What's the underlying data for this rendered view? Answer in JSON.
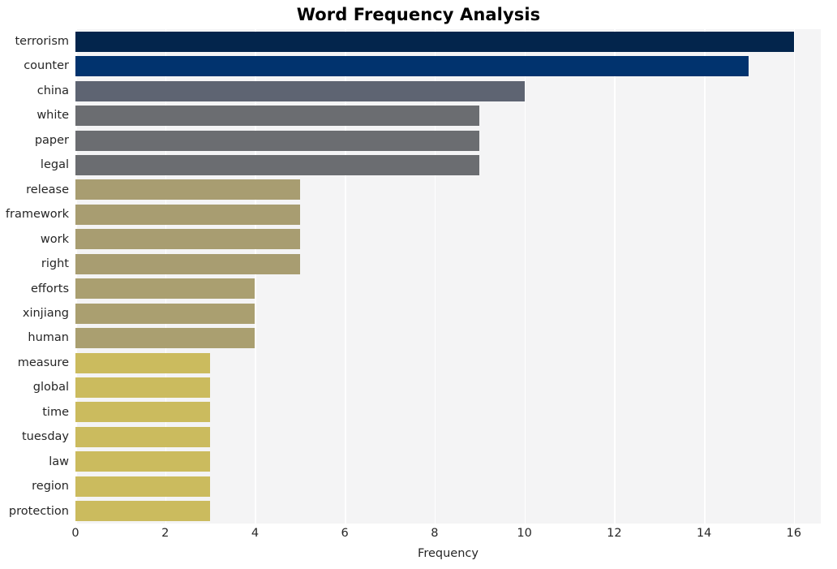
{
  "chart_data": {
    "type": "bar",
    "orientation": "horizontal",
    "title": "Word Frequency Analysis",
    "xlabel": "Frequency",
    "ylabel": "",
    "xlim": [
      0,
      16.6
    ],
    "xticks": [
      0,
      2,
      4,
      6,
      8,
      10,
      12,
      14,
      16
    ],
    "xtick_labels": [
      "0",
      "2",
      "4",
      "6",
      "8",
      "10",
      "12",
      "14",
      "16"
    ],
    "grid": "vertical-only",
    "legend": "none",
    "categories": [
      "terrorism",
      "counter",
      "china",
      "white",
      "paper",
      "legal",
      "release",
      "framework",
      "work",
      "right",
      "efforts",
      "xinjiang",
      "human",
      "measure",
      "global",
      "time",
      "tuesday",
      "law",
      "region",
      "protection"
    ],
    "values": [
      16,
      15,
      10,
      9,
      9,
      9,
      5,
      5,
      5,
      5,
      4,
      4,
      4,
      3,
      3,
      3,
      3,
      3,
      3,
      3
    ],
    "bar_colors": [
      "#03254c",
      "#01336e",
      "#5e6472",
      "#6b6d71",
      "#6b6d71",
      "#6b6d71",
      "#a89d71",
      "#a89d71",
      "#a89d71",
      "#a89d71",
      "#aa9f70",
      "#aa9f70",
      "#aa9f70",
      "#cbbb5e",
      "#cbbb5e",
      "#cbbb5e",
      "#cbbb5e",
      "#cbbb5e",
      "#cbbb5e",
      "#cbbb5e"
    ],
    "plot_background": "#f4f4f5",
    "gridline_color": "#ffffff",
    "figure_background": "#ffffff",
    "text_color": "#262626"
  }
}
